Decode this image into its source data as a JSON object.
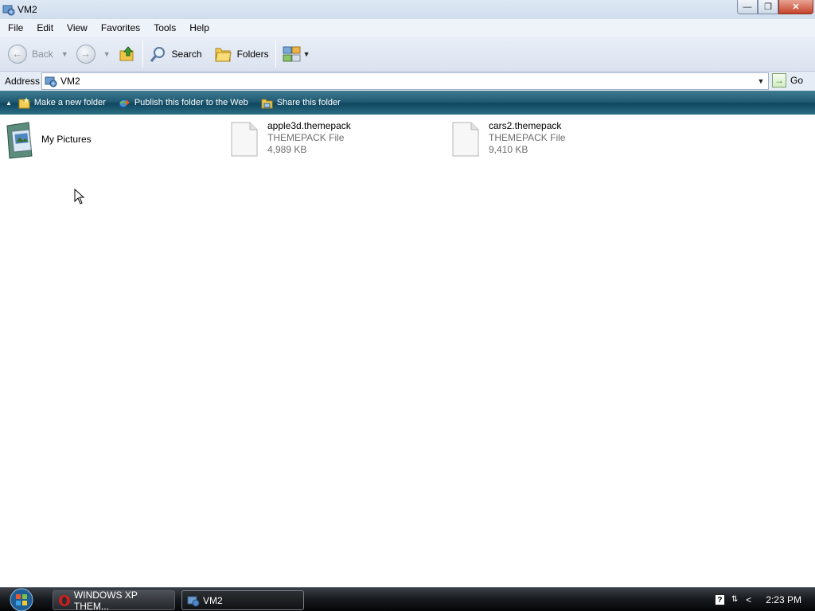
{
  "window": {
    "title": "VM2"
  },
  "menu": {
    "items": [
      "File",
      "Edit",
      "View",
      "Favorites",
      "Tools",
      "Help"
    ]
  },
  "toolbar": {
    "back_label": "Back",
    "search_label": "Search",
    "folders_label": "Folders"
  },
  "address": {
    "label": "Address",
    "value": "VM2",
    "go_label": "Go"
  },
  "tasks": {
    "make_folder": "Make a new folder",
    "publish": "Publish this folder to the Web",
    "share": "Share this folder"
  },
  "items": [
    {
      "name": "My Pictures"
    },
    {
      "name": "apple3d.themepack",
      "type": "THEMEPACK File",
      "size": "4,989 KB"
    },
    {
      "name": "cars2.themepack",
      "type": "THEMEPACK File",
      "size": "9,410 KB"
    }
  ],
  "taskbar": {
    "buttons": [
      "WINDOWS XP THEM...",
      "VM2"
    ],
    "clock": "2:23 PM"
  }
}
